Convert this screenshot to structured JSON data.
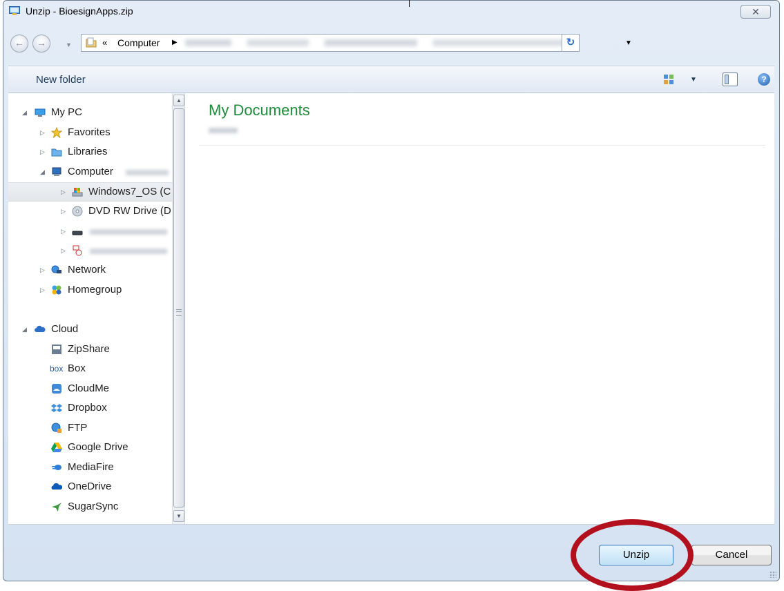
{
  "window": {
    "title": "Unzip - BioesignApps.zip",
    "close_glyph": "✕"
  },
  "navigation": {
    "back_glyph": "←",
    "forward_glyph": "→",
    "breadcrumb_chevron": "«",
    "breadcrumb_root": "Computer",
    "breadcrumb_arrow": "▶",
    "dropdown_glyph": "▼",
    "refresh_glyph": "↻"
  },
  "toolbar": {
    "new_folder_label": "New folder",
    "view_dropdown_glyph": "▼",
    "help_glyph": "?"
  },
  "tree": {
    "expanded_glyph": "◢",
    "collapsed_glyph": "▷",
    "my_pc": "My PC",
    "favorites": "Favorites",
    "libraries": "Libraries",
    "computer": "Computer",
    "windows_os": "Windows7_OS (C",
    "dvd_drive": "DVD RW Drive (D",
    "network": "Network",
    "homegroup": "Homegroup",
    "cloud": "Cloud",
    "zipshare": "ZipShare",
    "box": "Box",
    "box_logo": "box",
    "cloudme": "CloudMe",
    "dropbox": "Dropbox",
    "ftp": "FTP",
    "google_drive": "Google Drive",
    "mediafire": "MediaFire",
    "onedrive": "OneDrive",
    "sugarsync": "SugarSync"
  },
  "scrollbar": {
    "up_glyph": "▲",
    "down_glyph": "▼"
  },
  "files": {
    "folder_title": "My Documents"
  },
  "buttons": {
    "unzip": "Unzip",
    "cancel": "Cancel"
  },
  "colors": {
    "accent_green": "#1e8c3a",
    "highlight_ring": "#b3101e",
    "selection_bg": "#e3e6ea"
  }
}
